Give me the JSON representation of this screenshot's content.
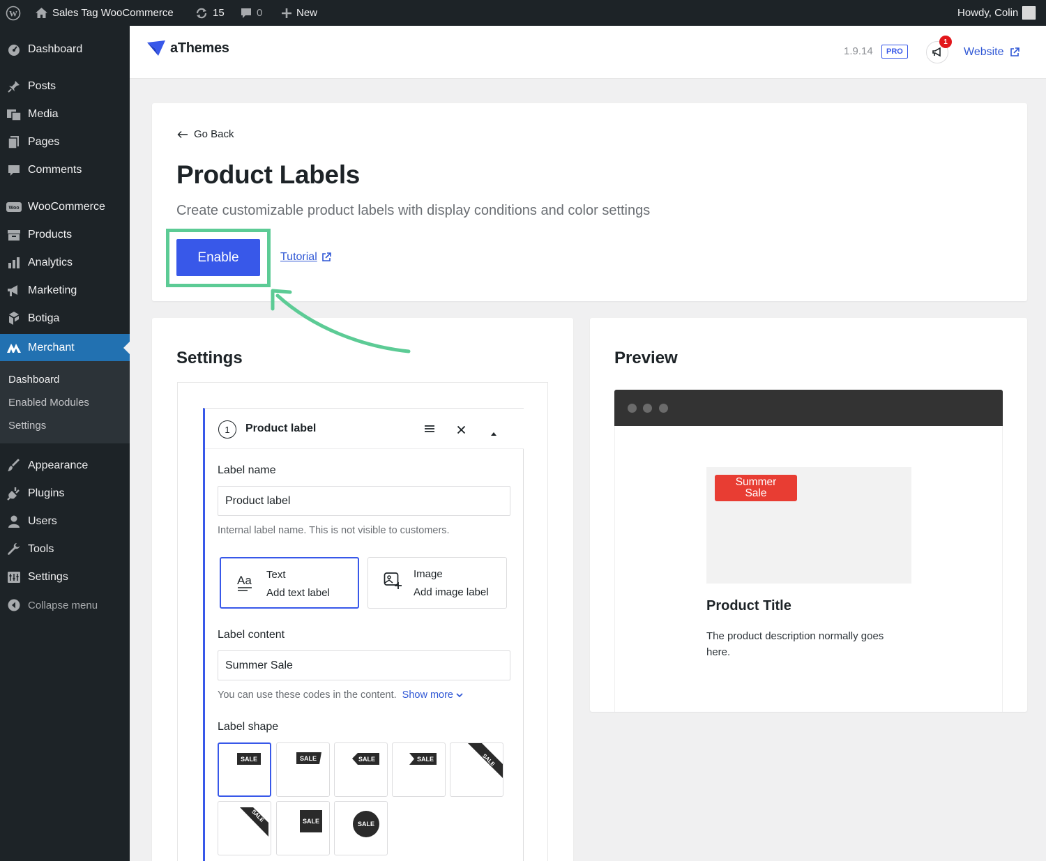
{
  "admin_bar": {
    "site_name": "Sales Tag WooCommerce",
    "updates_count": "15",
    "comments_count": "0",
    "new_label": "New",
    "greeting": "Howdy, Colin"
  },
  "sidebar": {
    "items": [
      {
        "label": "Dashboard",
        "icon": "dashboard-icon"
      },
      {
        "label": "Posts",
        "icon": "pin-icon"
      },
      {
        "label": "Media",
        "icon": "media-icon"
      },
      {
        "label": "Pages",
        "icon": "pages-icon"
      },
      {
        "label": "Comments",
        "icon": "comment-icon"
      },
      {
        "label": "WooCommerce",
        "icon": "woo-icon"
      },
      {
        "label": "Products",
        "icon": "archive-icon"
      },
      {
        "label": "Analytics",
        "icon": "bar-chart-icon"
      },
      {
        "label": "Marketing",
        "icon": "megaphone-icon"
      },
      {
        "label": "Botiga",
        "icon": "botiga-icon"
      },
      {
        "label": "Merchant",
        "icon": "merchant-icon"
      },
      {
        "label": "Appearance",
        "icon": "brush-icon"
      },
      {
        "label": "Plugins",
        "icon": "plug-icon"
      },
      {
        "label": "Users",
        "icon": "user-icon"
      },
      {
        "label": "Tools",
        "icon": "wrench-icon"
      },
      {
        "label": "Settings",
        "icon": "settings-icon"
      },
      {
        "label": "Collapse menu",
        "icon": "collapse-icon"
      }
    ],
    "submenu": [
      "Dashboard",
      "Enabled Modules",
      "Settings"
    ]
  },
  "header": {
    "brand": "aThemes",
    "version": "1.9.14",
    "badge": "PRO",
    "notification_count": "1",
    "website_label": "Website"
  },
  "module": {
    "back_label": "Go Back",
    "title": "Product Labels",
    "description": "Create customizable product labels with display conditions and color settings",
    "enable_label": "Enable",
    "tutorial_label": "Tutorial"
  },
  "settings": {
    "title": "Settings",
    "panel": {
      "step": "1",
      "title": "Product label",
      "label_name_title": "Label name",
      "label_name_value": "Product label",
      "label_name_help": "Internal label name. This is not visible to customers.",
      "type_options": [
        {
          "title": "Text",
          "subtitle": "Add text label"
        },
        {
          "title": "Image",
          "subtitle": "Add image label"
        }
      ],
      "label_content_title": "Label content",
      "label_content_value": "Summer Sale",
      "label_content_help": "You can use these codes in the content.",
      "show_more": "Show more",
      "label_shape_title": "Label shape",
      "shape_text": "SALE"
    }
  },
  "preview": {
    "title": "Preview",
    "sale_label": "Summer\nSale",
    "product_title": "Product Title",
    "product_description": "The product description normally goes here."
  },
  "colors": {
    "accent": "#3858e9",
    "highlight": "#5ccb95",
    "sale_red": "#e83d33",
    "admin_dark": "#1d2327",
    "menu_active": "#2271b1"
  }
}
